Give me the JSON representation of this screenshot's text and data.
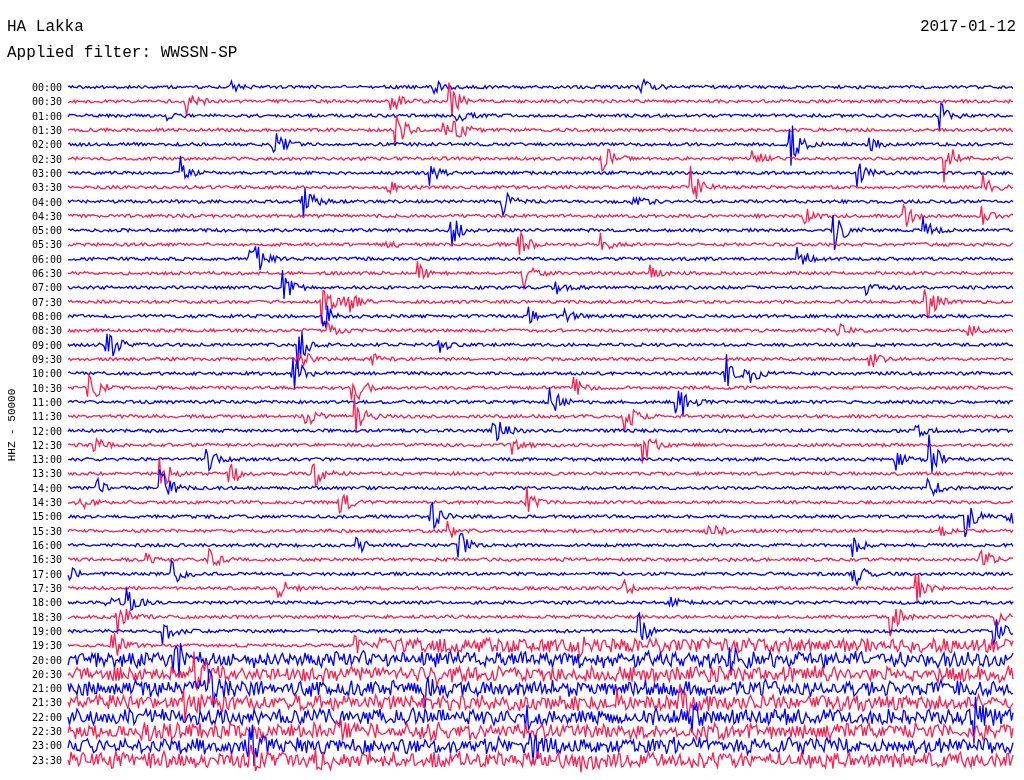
{
  "title": "HA Lakka",
  "date": "2017-01-12",
  "filter": "Applied filter: WWSSN-SP",
  "axis_label": "HHZ - 50000",
  "rows": [
    {
      "time": "00:00",
      "color": "#0000ff"
    },
    {
      "time": "00:30",
      "color": "#ff1e50"
    },
    {
      "time": "01:00",
      "color": "#0000ff"
    },
    {
      "time": "01:30",
      "color": "#ff1e50"
    },
    {
      "time": "02:00",
      "color": "#0000ff"
    },
    {
      "time": "02:30",
      "color": "#ff1e50"
    },
    {
      "time": "03:00",
      "color": "#0000ff"
    },
    {
      "time": "03:30",
      "color": "#ff1e50"
    },
    {
      "time": "04:00",
      "color": "#0000ff"
    },
    {
      "time": "04:30",
      "color": "#ff1e50"
    },
    {
      "time": "05:00",
      "color": "#0000ff"
    },
    {
      "time": "05:30",
      "color": "#ff1e50"
    },
    {
      "time": "06:00",
      "color": "#0000ff"
    },
    {
      "time": "06:30",
      "color": "#ff1e50"
    },
    {
      "time": "07:00",
      "color": "#0000ff"
    },
    {
      "time": "07:30",
      "color": "#ff1e50"
    },
    {
      "time": "08:00",
      "color": "#0000ff"
    },
    {
      "time": "08:30",
      "color": "#ff1e50"
    },
    {
      "time": "09:00",
      "color": "#0000ff"
    },
    {
      "time": "09:30",
      "color": "#ff1e50"
    },
    {
      "time": "10:00",
      "color": "#0000ff"
    },
    {
      "time": "10:30",
      "color": "#ff1e50"
    },
    {
      "time": "11:00",
      "color": "#0000ff"
    },
    {
      "time": "11:30",
      "color": "#ff1e50"
    },
    {
      "time": "12:00",
      "color": "#0000ff"
    },
    {
      "time": "12:30",
      "color": "#ff1e50"
    },
    {
      "time": "13:00",
      "color": "#0000ff"
    },
    {
      "time": "13:30",
      "color": "#ff1e50"
    },
    {
      "time": "14:00",
      "color": "#0000ff"
    },
    {
      "time": "14:30",
      "color": "#ff1e50"
    },
    {
      "time": "15:00",
      "color": "#0000ff"
    },
    {
      "time": "15:30",
      "color": "#ff1e50"
    },
    {
      "time": "16:00",
      "color": "#0000ff"
    },
    {
      "time": "16:30",
      "color": "#ff1e50"
    },
    {
      "time": "17:00",
      "color": "#0000ff"
    },
    {
      "time": "17:30",
      "color": "#ff1e50"
    },
    {
      "time": "18:00",
      "color": "#0000ff"
    },
    {
      "time": "18:30",
      "color": "#ff1e50"
    },
    {
      "time": "19:00",
      "color": "#0000ff"
    },
    {
      "time": "19:30",
      "color": "#ff1e50"
    },
    {
      "time": "20:00",
      "color": "#0000ff"
    },
    {
      "time": "20:30",
      "color": "#ff1e50"
    },
    {
      "time": "21:00",
      "color": "#0000ff"
    },
    {
      "time": "21:30",
      "color": "#ff1e50"
    },
    {
      "time": "22:00",
      "color": "#0000ff"
    },
    {
      "time": "22:30",
      "color": "#ff1e50"
    },
    {
      "time": "23:00",
      "color": "#0000ff"
    },
    {
      "time": "23:30",
      "color": "#ff1e50"
    }
  ]
}
